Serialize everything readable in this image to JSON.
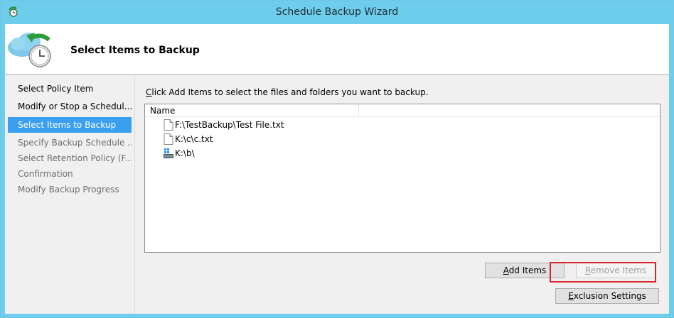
{
  "window": {
    "title": "Schedule Backup Wizard"
  },
  "header": {
    "heading": "Select Items to Backup",
    "icon": "cloud-backup-clock-icon"
  },
  "nav": {
    "items": [
      {
        "label": "Select Policy Item",
        "state": "normal"
      },
      {
        "label": "Modify or Stop a Schedul...",
        "state": "normal"
      },
      {
        "label": "Select Items to Backup",
        "state": "active"
      },
      {
        "label": "Specify Backup Schedule ...",
        "state": "disabled"
      },
      {
        "label": "Select Retention Policy (F...",
        "state": "disabled"
      },
      {
        "label": "Confirmation",
        "state": "disabled"
      },
      {
        "label": "Modify Backup Progress",
        "state": "disabled"
      }
    ]
  },
  "main": {
    "instruction_underlined": "C",
    "instruction_rest": "lick Add Items to select the files and folders you want to backup.",
    "list": {
      "column_header": "Name",
      "items": [
        {
          "label": "F:\\TestBackup\\Test File.txt",
          "icon": "file-icon"
        },
        {
          "label": "K:\\c\\c.txt",
          "icon": "file-icon"
        },
        {
          "label": "K:\\b\\",
          "icon": "drive-icon"
        }
      ]
    }
  },
  "buttons": {
    "add_items_underlined": "A",
    "add_items_rest": "dd Items",
    "remove_items_underlined": "R",
    "remove_items_rest": "emove Items",
    "exclusion_underlined": "E",
    "exclusion_rest": "xclusion Settings"
  },
  "colors": {
    "accent": "#3a9ff1",
    "titlebar": "#6fcdec",
    "highlight_border": "#d6252d"
  }
}
